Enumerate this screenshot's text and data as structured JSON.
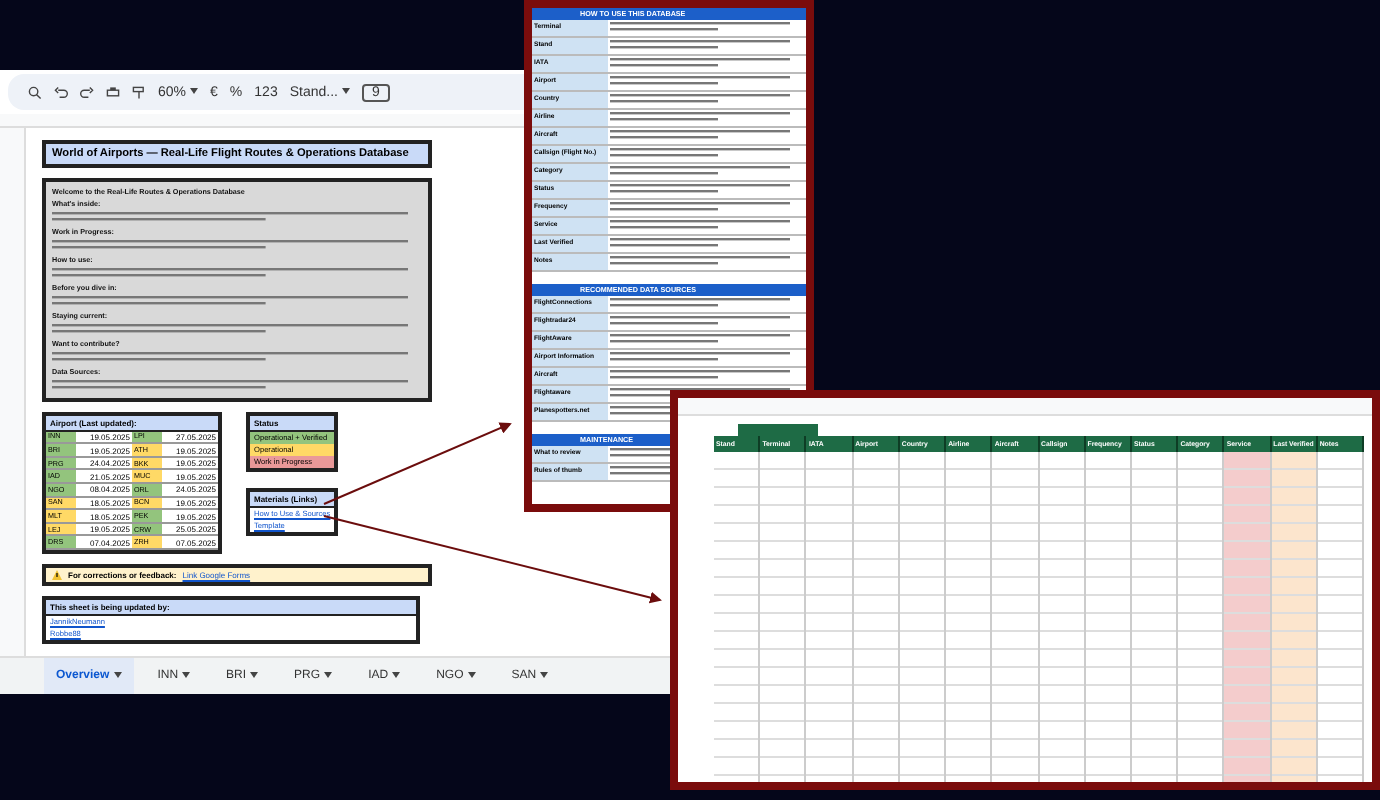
{
  "toolbar": {
    "zoom": "60%",
    "currency": "€",
    "percent": "%",
    "number_format": "123",
    "font": "Stand...",
    "font_size": "9"
  },
  "overview": {
    "title": "World of Airports — Real-Life Flight Routes & Operations Database",
    "intro_headings": [
      "Welcome to the Real-Life Routes & Operations Database",
      "What's inside:",
      "Work in Progress:",
      "How to use:",
      "Before you dive in:",
      "Staying current:",
      "Want to contribute?",
      "Data Sources:"
    ],
    "airports_title": "Airport (Last updated):",
    "airports": [
      {
        "code": "INN",
        "date": "19.05.2025",
        "color": "#93c47d"
      },
      {
        "code": "BRI",
        "date": "19.05.2025",
        "color": "#93c47d"
      },
      {
        "code": "PRG",
        "date": "24.04.2025",
        "color": "#93c47d"
      },
      {
        "code": "IAD",
        "date": "21.05.2025",
        "color": "#93c47d"
      },
      {
        "code": "NGO",
        "date": "08.04.2025",
        "color": "#93c47d"
      },
      {
        "code": "SAN",
        "date": "18.05.2025",
        "color": "#ffd966"
      },
      {
        "code": "MLT",
        "date": "18.05.2025",
        "color": "#ffd966"
      },
      {
        "code": "LEJ",
        "date": "19.05.2025",
        "color": "#ffd966"
      },
      {
        "code": "DRS",
        "date": "07.04.2025",
        "color": "#93c47d"
      },
      {
        "code": "LPI",
        "date": "27.05.2025",
        "color": "#93c47d"
      },
      {
        "code": "ATH",
        "date": "19.05.2025",
        "color": "#ffd966"
      },
      {
        "code": "BKK",
        "date": "19.05.2025",
        "color": "#ffd966"
      },
      {
        "code": "MUC",
        "date": "19.05.2025",
        "color": "#ffd966"
      },
      {
        "code": "ORL",
        "date": "24.05.2025",
        "color": "#93c47d"
      },
      {
        "code": "BCN",
        "date": "19.05.2025",
        "color": "#ffd966"
      },
      {
        "code": "PEK",
        "date": "19.05.2025",
        "color": "#93c47d"
      },
      {
        "code": "CRW",
        "date": "25.05.2025",
        "color": "#93c47d"
      },
      {
        "code": "ZRH",
        "date": "07.05.2025",
        "color": "#ffd966"
      }
    ],
    "status_title": "Status",
    "statuses": [
      {
        "label": "Operational + Verified",
        "color": "#93c47d"
      },
      {
        "label": "Operational",
        "color": "#ffd966"
      },
      {
        "label": "Work in Progress",
        "color": "#ea9999"
      }
    ],
    "materials_title": "Materials (Links)",
    "materials": [
      "How to Use & Sources",
      "Template"
    ],
    "feedback_label": "For corrections or feedback:",
    "feedback_link": "Link Google Forms",
    "updated_title": "This sheet is being updated by:",
    "updaters": [
      "JannikNeumann",
      "Robbe88"
    ]
  },
  "sheet_tabs": [
    {
      "label": "Overview",
      "selected": true
    },
    {
      "label": "INN",
      "selected": false
    },
    {
      "label": "BRI",
      "selected": false
    },
    {
      "label": "PRG",
      "selected": false
    },
    {
      "label": "IAD",
      "selected": false
    },
    {
      "label": "NGO",
      "selected": false
    },
    {
      "label": "SAN",
      "selected": false
    }
  ],
  "guide": {
    "sections": [
      {
        "title": "HOW TO USE THIS DATABASE",
        "rows": [
          "Terminal",
          "Stand",
          "IATA",
          "Airport",
          "Country",
          "Airline",
          "Aircraft",
          "Callsign (Flight No.)",
          "Category",
          "Status",
          "Frequency",
          "Service",
          "Last Verified",
          "Notes"
        ]
      },
      {
        "title": "RECOMMENDED DATA SOURCES",
        "rows": [
          "FlightConnections",
          "Flightradar24",
          "FlightAware",
          "Airport Information",
          "Aircraft",
          "Flightaware",
          "Planespotters.net"
        ]
      },
      {
        "title": "MAINTENANCE",
        "rows": [
          "What to review",
          "Rules of thumb"
        ]
      }
    ]
  },
  "template": {
    "columns": [
      {
        "label": "Stand",
        "color": "#ffffff"
      },
      {
        "label": "Terminal",
        "color": "#ffffff"
      },
      {
        "label": "IATA",
        "color": "#ffffff"
      },
      {
        "label": "Airport",
        "color": "#ffffff"
      },
      {
        "label": "Country",
        "color": "#ffffff"
      },
      {
        "label": "Airline",
        "color": "#ffffff"
      },
      {
        "label": "Aircraft",
        "color": "#ffffff"
      },
      {
        "label": "Callsign",
        "color": "#ffffff"
      },
      {
        "label": "Frequency",
        "color": "#ffffff"
      },
      {
        "label": "Status",
        "color": "#ffffff"
      },
      {
        "label": "Category",
        "color": "#ffffff"
      },
      {
        "label": "Service",
        "color": "#f4cccc"
      },
      {
        "label": "Last Verified",
        "color": "#fce5cd"
      },
      {
        "label": "Notes",
        "color": "#ffffff"
      }
    ]
  }
}
